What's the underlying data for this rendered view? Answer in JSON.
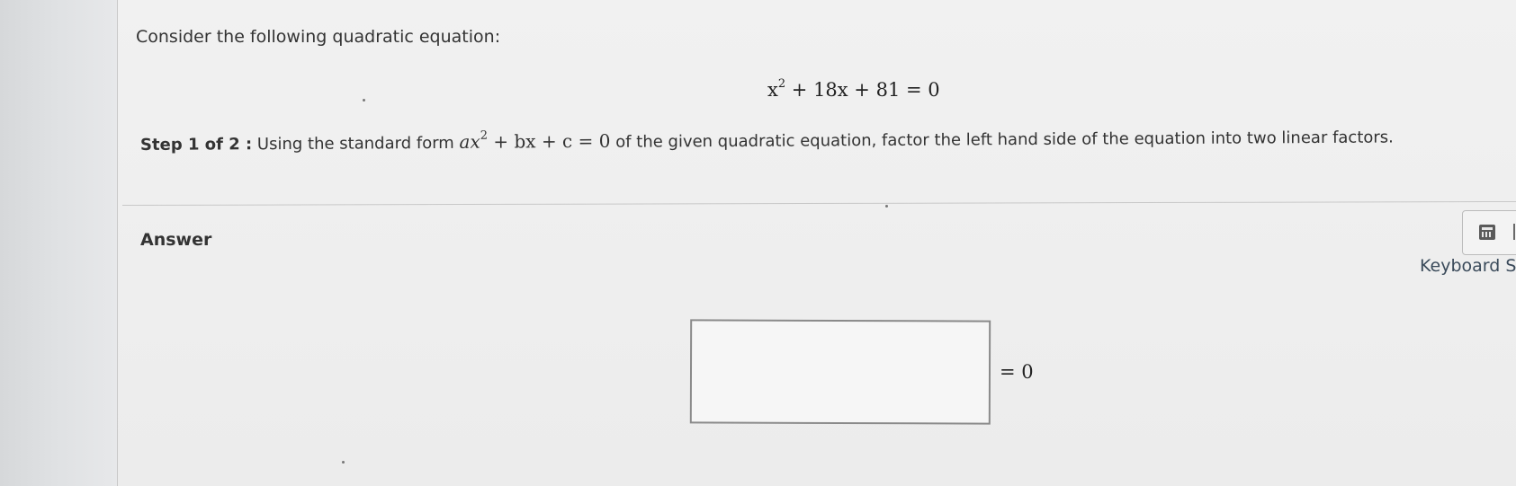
{
  "question": {
    "intro": "Consider the following quadratic equation:",
    "equation": {
      "lhs_base": "x",
      "lhs_exp": "2",
      "rest": " + 18x + 81 = 0"
    },
    "step": {
      "label": "Step 1 of 2 :",
      "text_before": " Using the standard form ",
      "std_form": {
        "a_term": "ax",
        "exp": "2",
        "rest": " + bx + c = 0"
      },
      "text_after": " of the given quadratic equation, factor the left hand side of the equation into two linear factors."
    }
  },
  "answer": {
    "label": "Answer",
    "input_value": "",
    "equals_text": "= 0"
  },
  "tools": {
    "calculator_icon": "calculator-icon",
    "keyboard_label": "Keyboard S"
  }
}
